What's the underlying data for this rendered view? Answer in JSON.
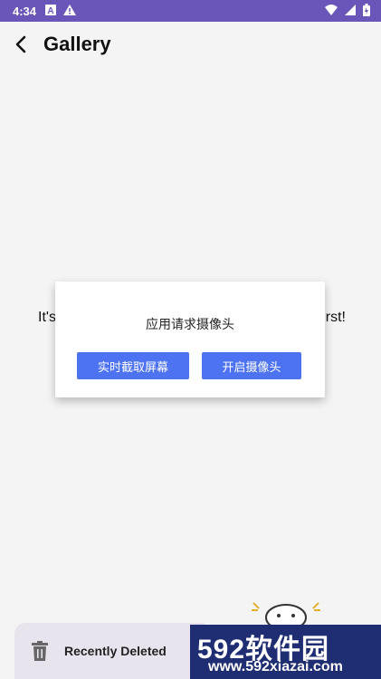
{
  "status_bar": {
    "time": "4:34",
    "left_icons": [
      "a-box-icon",
      "warning-icon"
    ],
    "right_icons": [
      "wifi-icon",
      "signal-icon",
      "battery-icon"
    ]
  },
  "appbar": {
    "title": "Gallery",
    "back_icon": "arrow-back-icon"
  },
  "background_message": {
    "left_visible": "It's",
    "right_visible": "rst!"
  },
  "dialog": {
    "title": "应用请求摄像头",
    "buttons": [
      {
        "label": "实时截取屏幕"
      },
      {
        "label": "开启摄像头"
      }
    ]
  },
  "bottom": {
    "recently_deleted": "Recently Deleted",
    "trash_icon": "trash-icon"
  },
  "watermark": {
    "big": "592软件园",
    "small": "www.592xiazai.com"
  },
  "colors": {
    "status_bar": "#6a56b9",
    "button": "#4e73f2",
    "background": "#f4f4f4"
  }
}
